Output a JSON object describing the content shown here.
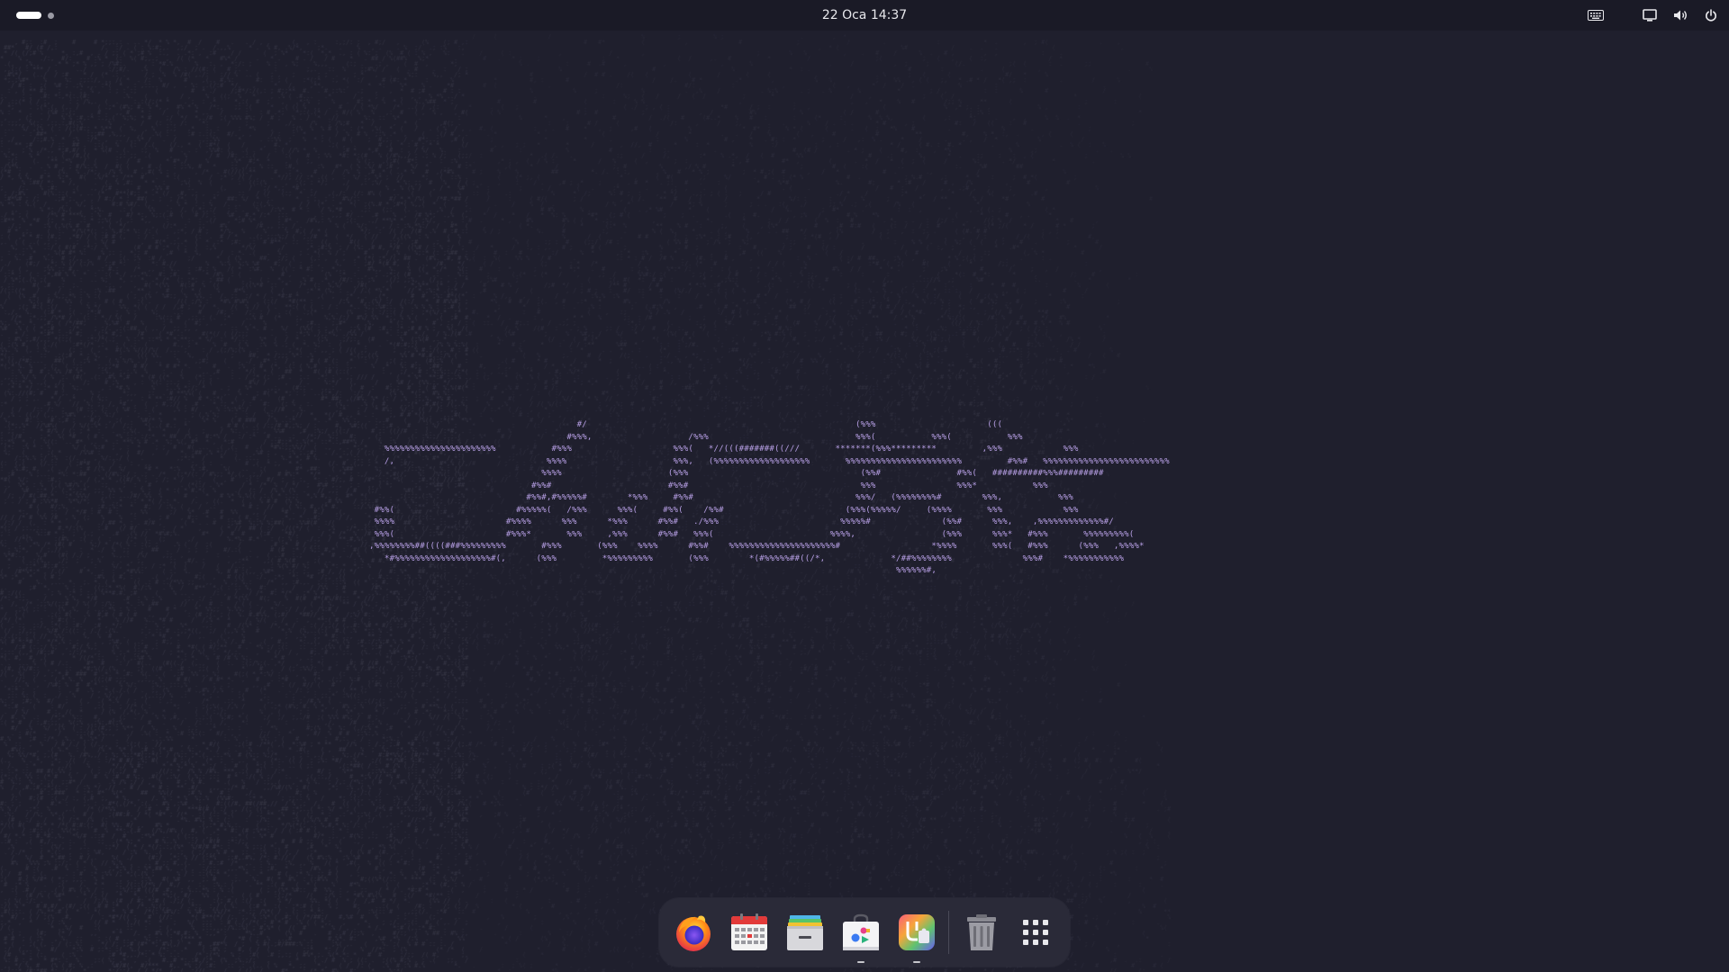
{
  "topbar": {
    "workspace_indicator": {
      "active_index": 0,
      "count": 2
    },
    "datetime": "22 Oca  14:37",
    "tray": [
      {
        "name": "keyboard-icon"
      },
      {
        "name": "screen-icon"
      },
      {
        "name": "volume-icon"
      },
      {
        "name": "power-icon"
      }
    ]
  },
  "wallpaper": {
    "ascii_title_lines": [
      "                                         #/                                                     (%%%                      (((                ",
      "                                       #%%%,                   /%%%                             %%%(           %%%(           %%%               ",
      "   %%%%%%%%%%%%%%%%%%%%%%           #%%%                    %%%(   *//(((#######((///       *******(%%%*********         ,%%%            %%%               ",
      "   /,                              %%%%                     %%%,   (%%%%%%%%%%%%%%%%%%%       %%%%%%%%%%%%%%%%%%%%%%%         #%%#   %%%%%%%%%%%%%%%%%%%%%%%%%",
      "                                  %%%%                     (%%%                                  (%%#               #%%(   ##########%%%#########",
      "                                #%%#                       #%%#                                  %%%                %%%*           %%%               ",
      "                               #%%#,#%%%%%#        *%%%     #%%#                                %%%/   (%%%%%%%%#        %%%,           %%%               ",
      " #%%(                        #%%%%%(   /%%%      %%%(     #%%(    /%%#                        (%%%(%%%%%/     (%%%%       %%%            %%%               ",
      " %%%%                      #%%%%      %%%      *%%%      #%%#   ./%%%                        %%%%%#              (%%#      %%%,    ,%%%%%%%%%%%%%#/         ",
      " %%%(                      #%%%*       %%%     ,%%%      #%%#   %%%(                       %%%%,                 (%%%      %%%*   #%%%       %%%%%%%%%(     ",
      ",%%%%%%%%##((((###%%%%%%%%%       #%%%       (%%%    %%%%      #%%#    %%%%%%%%%%%%%%%%%%%%%#                  *%%%%       %%%(   #%%%      (%%%   ,%%%%*  ",
      "   *#%%%%%%%%%%%%%%%%%%%#(,      (%%%         *%%%%%%%%%       (%%%        *(#%%%%%##((/*,             */##%%%%%%%%              %%%#    *%%%%%%%%%%%         ",
      "                                                                                                        %%%%%%#,                                              "
    ]
  },
  "dock": {
    "apps": [
      {
        "name": "firefox-icon",
        "running": false
      },
      {
        "name": "calendar-icon",
        "running": false
      },
      {
        "name": "archive-manager-icon",
        "running": false
      },
      {
        "name": "software-store-icon",
        "running": true
      },
      {
        "name": "extension-manager-icon",
        "running": true
      }
    ],
    "trash": {
      "name": "trash-icon"
    },
    "show_apps": {
      "name": "show-apps-icon"
    }
  },
  "colors": {
    "background": "#1f1f2d",
    "topbar": "#1a1a26",
    "ascii_art": "#b8a0e6",
    "dock": "#2a2a38"
  }
}
